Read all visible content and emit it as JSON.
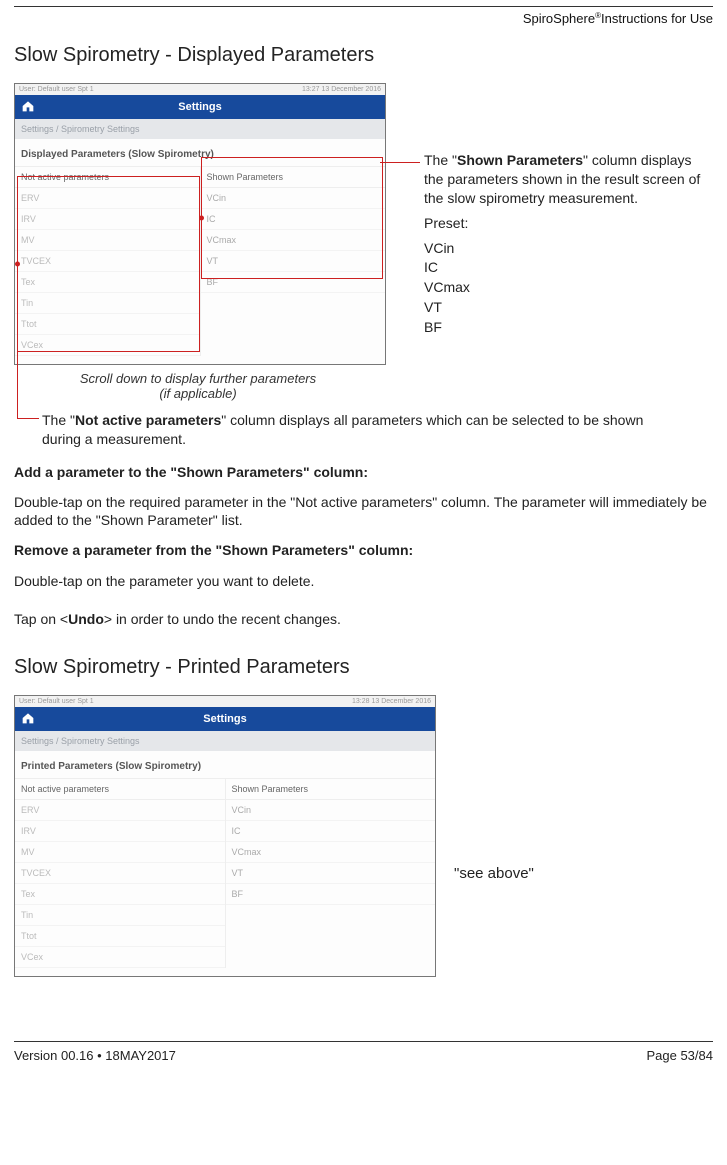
{
  "header": {
    "product": "SpiroSphere",
    "reg": "®",
    "tail": " Instructions for Use"
  },
  "section1_title": "Slow Spirometry - Displayed Parameters",
  "shot1": {
    "status_left": "User: Default user Spt 1",
    "status_right": "13:27 13 December 2016",
    "titlebar": "Settings",
    "breadcrumb": "Settings / Spirometry Settings",
    "panel_title": "Displayed Parameters (Slow Spirometry)",
    "col_left_head": "Not active parameters",
    "col_right_head": "Shown Parameters",
    "left_items": [
      "ERV",
      "IRV",
      "MV",
      "TVCEX",
      "Tex",
      "Tin",
      "Ttot",
      "VCex"
    ],
    "right_items": [
      "VCin",
      "IC",
      "VCmax",
      "VT",
      "BF"
    ]
  },
  "scroll_note_line1": "Scroll down to display further parameters",
  "scroll_note_line2": "(if applicable)",
  "side": {
    "p1_before": "The \"",
    "p1_bold": "Shown Parameters",
    "p1_after": "\" column displays the parameters shown in the result screen of the slow spirometry measurement.",
    "preset_label": "Preset:",
    "preset_items": [
      "VCin",
      "IC",
      "VCmax",
      "VT",
      "BF"
    ]
  },
  "not_active": {
    "before": "The \"",
    "bold": "Not active parameters",
    "after": "\" column displays all parameters which can be selected to be shown during a measurement."
  },
  "body": {
    "add_head": "Add a parameter to the \"Shown Parameters\" column:",
    "add_text": "Double-tap on the required parameter in the \"Not active parameters\" column. The parameter will immediately be added to the \"Shown Parameter\" list.",
    "remove_head": "Remove a parameter from the \"Shown Parameters\" column:",
    "remove_text": "Double-tap on the parameter you want to delete.",
    "undo_before": "Tap on <",
    "undo_bold": "Undo",
    "undo_after": "> in order to undo the recent changes."
  },
  "section2_title": "Slow Spirometry - Printed Parameters",
  "shot2": {
    "status_left": "User: Default user Spt 1",
    "status_right": "13:28 13 December 2016",
    "titlebar": "Settings",
    "breadcrumb": "Settings / Spirometry Settings",
    "panel_title": "Printed Parameters (Slow Spirometry)",
    "col_left_head": "Not active parameters",
    "col_right_head": "Shown Parameters",
    "left_items": [
      "ERV",
      "IRV",
      "MV",
      "TVCEX",
      "Tex",
      "Tin",
      "Ttot",
      "VCex"
    ],
    "right_items": [
      "VCin",
      "IC",
      "VCmax",
      "VT",
      "BF"
    ]
  },
  "see_above": "\"see above\"",
  "footer": {
    "left": "Version 00.16 • 18MAY2017",
    "right": "Page 53/84"
  }
}
